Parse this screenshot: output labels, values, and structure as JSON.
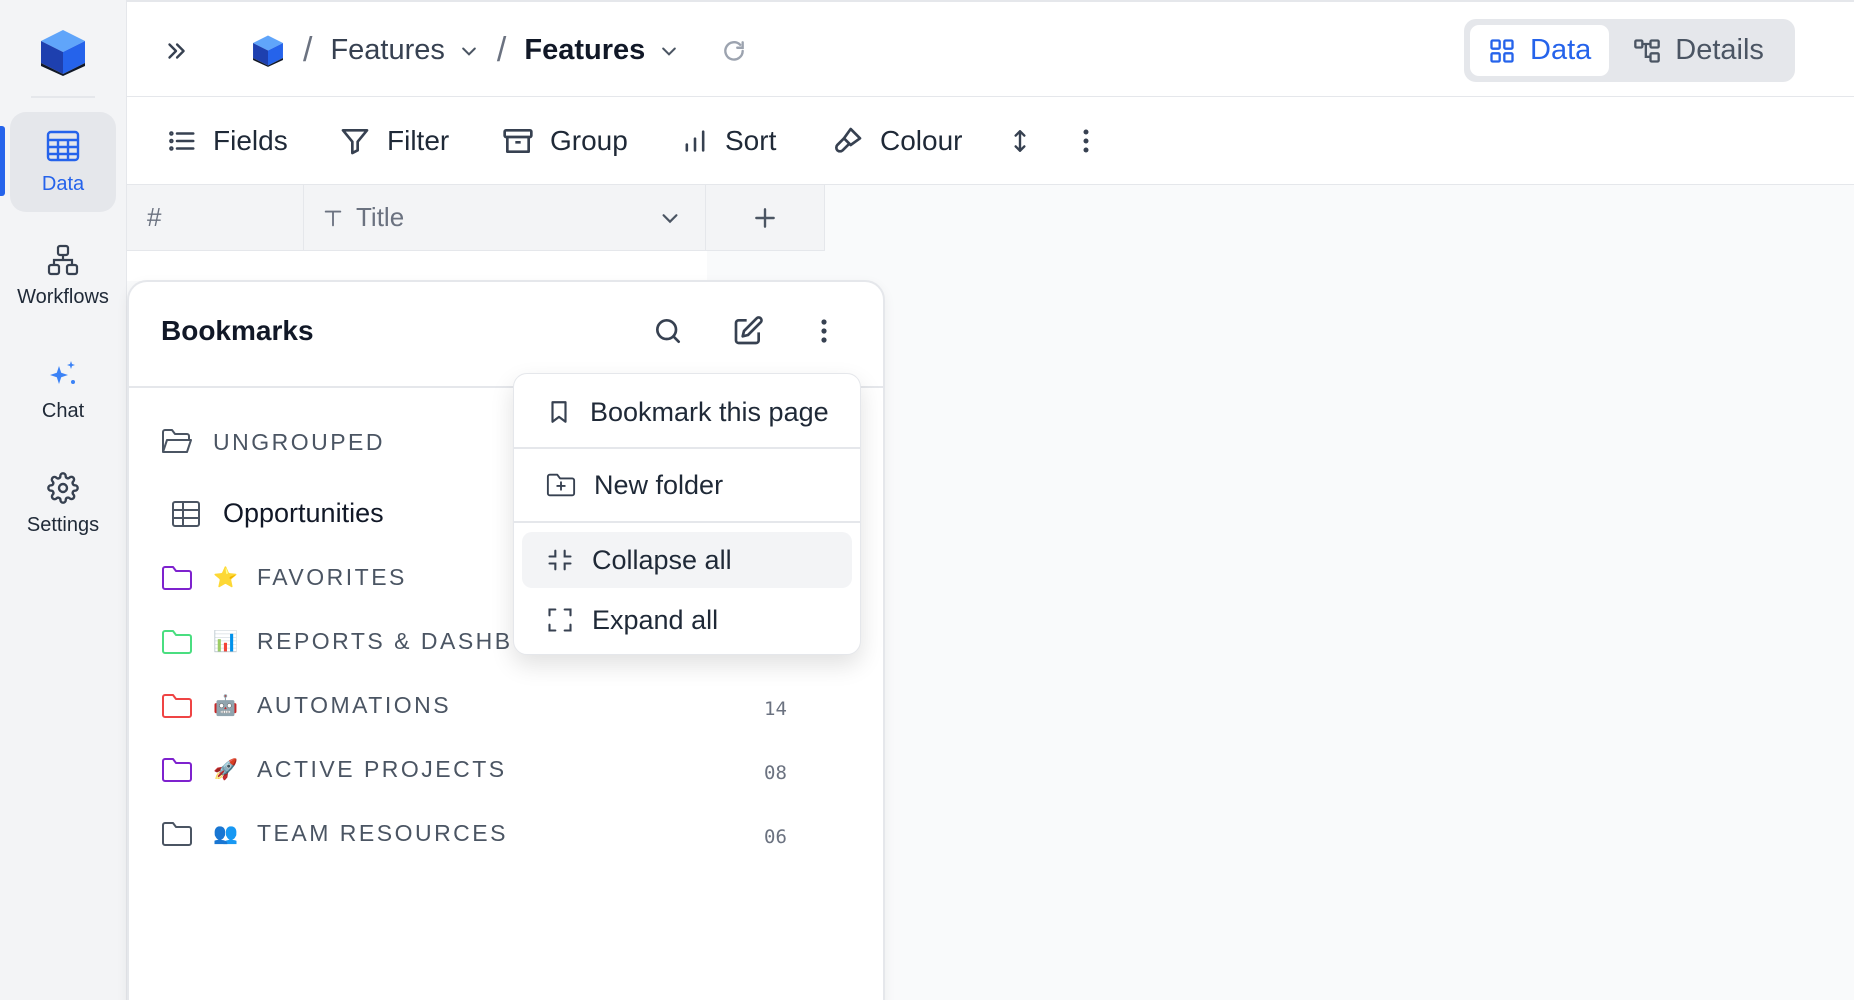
{
  "nav": {
    "items": [
      {
        "label": "Data",
        "icon": "table-icon",
        "active": true
      },
      {
        "label": "Workflows",
        "icon": "workflow-icon"
      },
      {
        "label": "Chat",
        "icon": "sparkles-icon"
      },
      {
        "label": "Settings",
        "icon": "gear-icon"
      }
    ]
  },
  "breadcrumb": {
    "items": [
      {
        "label": "Features"
      },
      {
        "label": "Features"
      }
    ]
  },
  "view_toggle": {
    "data_label": "Data",
    "details_label": "Details",
    "active": "Data"
  },
  "toolbar": {
    "fields": "Fields",
    "filter": "Filter",
    "group": "Group",
    "sort": "Sort",
    "colour": "Colour"
  },
  "grid": {
    "row_number_header": "#",
    "columns": [
      {
        "label": "Title",
        "type_icon": "text-type-icon"
      }
    ]
  },
  "bookmarks": {
    "title": "Bookmarks",
    "ungrouped_label": "UNGROUPED",
    "ungrouped_items": [
      {
        "label": "Opportunities",
        "icon": "table-icon"
      }
    ],
    "folders": [
      {
        "emoji": "⭐",
        "label": "FAVORITES",
        "count": "",
        "color": "#7e22ce"
      },
      {
        "emoji": "📊",
        "label": "REPORTS & DASHBOARDS",
        "count": "",
        "color": "#4ade80"
      },
      {
        "emoji": "🤖",
        "label": "AUTOMATIONS",
        "count": "14",
        "color": "#ef4444"
      },
      {
        "emoji": "🚀",
        "label": "ACTIVE PROJECTS",
        "count": "08",
        "color": "#7e22ce"
      },
      {
        "emoji": "👥",
        "label": "TEAM RESOURCES",
        "count": "06",
        "color": "#4b5563"
      }
    ]
  },
  "menu": {
    "items": [
      {
        "label": "Bookmark this page",
        "icon": "bookmark-icon"
      },
      {
        "label": "New folder",
        "icon": "folder-plus-icon"
      },
      {
        "label": "Collapse all",
        "icon": "collapse-icon",
        "hovered": true
      },
      {
        "label": "Expand all",
        "icon": "expand-icon"
      }
    ]
  },
  "colors": {
    "accent": "#2563eb",
    "brand": "#3b82f6"
  }
}
